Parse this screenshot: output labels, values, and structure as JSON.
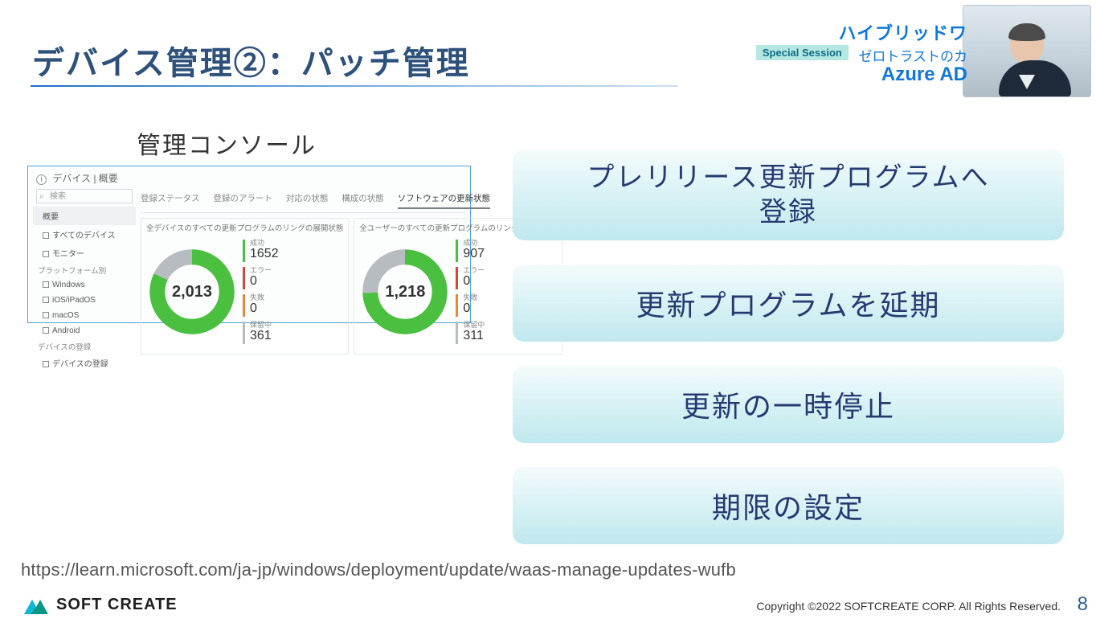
{
  "header": {
    "line1": "ハイブリッドワ",
    "badge": "Special Session",
    "line2": "ゼロトラストのカ",
    "line3": "Azure AD"
  },
  "title": "デバイス管理②：パッチ管理",
  "console": {
    "caption": "管理コンソール",
    "breadcrumb": "デバイス | 概要",
    "searchPlaceholder": "検索",
    "sidebar": {
      "items": [
        {
          "label": "概要",
          "selected": true
        },
        {
          "label": "すべてのデバイス"
        },
        {
          "label": "モニター"
        }
      ],
      "groupPlatform": "プラットフォーム別",
      "platforms": [
        {
          "label": "Windows"
        },
        {
          "label": "iOS/iPadOS"
        },
        {
          "label": "macOS"
        },
        {
          "label": "Android"
        }
      ],
      "groupEnroll": "デバイスの登録",
      "enroll": [
        {
          "label": "デバイスの登録"
        }
      ]
    },
    "tabs": [
      {
        "label": "登録ステータス"
      },
      {
        "label": "登録のアラート"
      },
      {
        "label": "対応の状態"
      },
      {
        "label": "構成の状態"
      },
      {
        "label": "ソフトウェアの更新状態",
        "active": true
      }
    ]
  },
  "chart_data": [
    {
      "type": "pie",
      "title": "全デバイスのすべての更新プログラムのリングの展開状態",
      "total": "2,013",
      "series": [
        {
          "name": "成功",
          "value": 1652,
          "color": "#4bbf3f"
        },
        {
          "name": "エラー",
          "value": 0,
          "color": "#d04a3d"
        },
        {
          "name": "失敗",
          "value": 0,
          "color": "#e1893d"
        },
        {
          "name": "保留中",
          "value": 361,
          "color": "#b7bcc1"
        }
      ]
    },
    {
      "type": "pie",
      "title": "全ユーザーのすべての更新プログラムのリングの展開状態",
      "total": "1,218",
      "series": [
        {
          "name": "成功",
          "value": 907,
          "color": "#4bbf3f"
        },
        {
          "name": "エラー",
          "value": 0,
          "color": "#d04a3d"
        },
        {
          "name": "失敗",
          "value": 0,
          "color": "#e1893d"
        },
        {
          "name": "保留中",
          "value": 311,
          "color": "#b7bcc1"
        }
      ]
    }
  ],
  "bullets": [
    "プレリリース更新プログラムへ登録",
    "更新プログラムを延期",
    "更新の一時停止",
    "期限の設定"
  ],
  "url": "https://learn.microsoft.com/ja-jp/windows/deployment/update/waas-manage-updates-wufb",
  "footer": {
    "brand": "SOFT CREATE",
    "copyright": "Copyright ©2022 SOFTCREATE CORP. All Rights Reserved.",
    "page": "8"
  }
}
